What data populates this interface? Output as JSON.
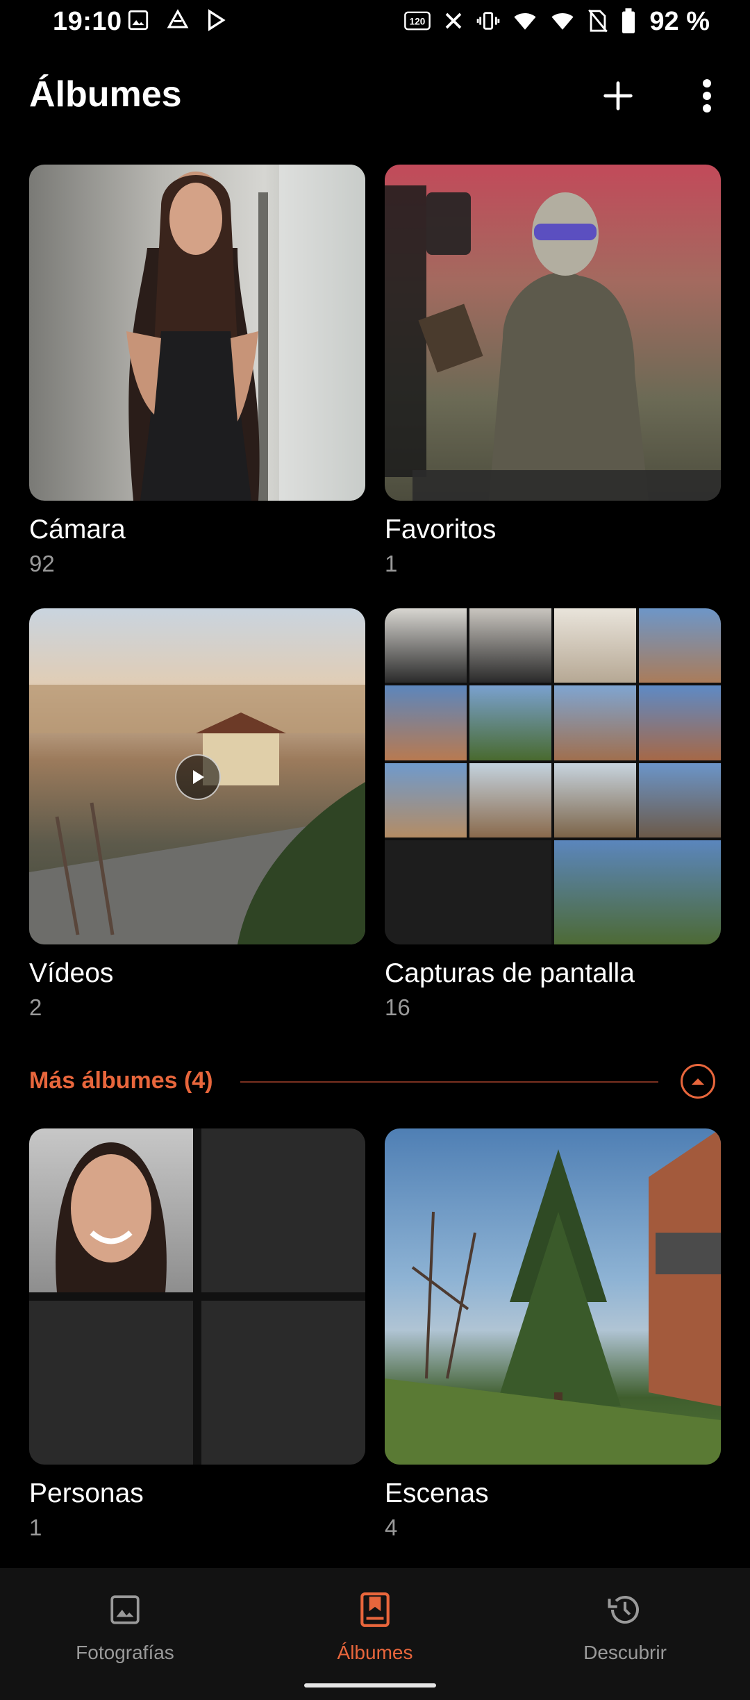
{
  "status_bar": {
    "time": "19:10",
    "battery_percent": "92 %",
    "refresh_rate": "120"
  },
  "header": {
    "title": "Álbumes"
  },
  "albums": [
    {
      "name": "Cámara",
      "count": "92"
    },
    {
      "name": "Favoritos",
      "count": "1"
    },
    {
      "name": "Vídeos",
      "count": "2"
    },
    {
      "name": "Capturas de pantalla",
      "count": "16"
    }
  ],
  "more_albums": {
    "label": "Más álbumes (4)",
    "albums": [
      {
        "name": "Personas",
        "count": "1"
      },
      {
        "name": "Escenas",
        "count": "4"
      }
    ]
  },
  "bottom_nav": {
    "items": [
      {
        "label": "Fotografías",
        "icon": "image-icon"
      },
      {
        "label": "Álbumes",
        "icon": "album-icon"
      },
      {
        "label": "Descubrir",
        "icon": "discover-icon"
      }
    ],
    "active": "Álbumes"
  },
  "colors": {
    "accent": "#e8663c",
    "background": "#000000",
    "nav_background": "#121212"
  }
}
